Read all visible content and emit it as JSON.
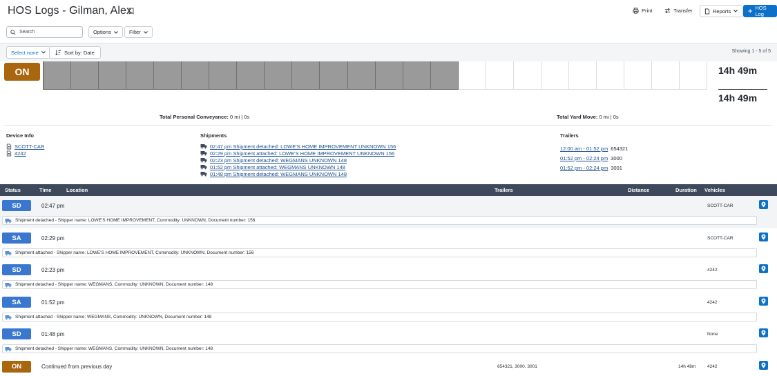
{
  "header": {
    "title": "HOS Logs - Gilman, Alex",
    "print_label": "Print",
    "transfer_label": "Transfer",
    "reports_label": "Reports",
    "hos_log_label": "HOS Log"
  },
  "toolbar": {
    "search_placeholder": "Search",
    "options_label": "Options",
    "filter_label": "Filter",
    "select_label": "Select none",
    "sort_label": "Sort by: Date",
    "showing": "Showing 1 - 5 of 5"
  },
  "chart": {
    "status_badge": "ON",
    "total_top": "14h 49m",
    "total_bottom": "14h 49m",
    "personal_conveyance_label": "Total Personal Conveyance:",
    "personal_conveyance_value": "0 mi | 0s",
    "yard_move_label": "Total Yard Move:",
    "yard_move_value": "0 mi | 0s",
    "on_duty_fraction": 0.617
  },
  "device_info": {
    "title": "Device Info",
    "items": [
      "SCOTT-CAR",
      "4242"
    ]
  },
  "shipments": {
    "title": "Shipments",
    "items": [
      "02:47 pm Shipment detached: LOWE'S HOME IMPROVEMENT UNKNOWN 156",
      "02:29 pm Shipment attached: LOWE'S HOME IMPROVEMENT UNKNOWN 156",
      "02:23 pm Shipment detached: WEGMANS UNKNOWN 148",
      "01:52 pm Shipment attached: WEGMANS UNKNOWN 148",
      "01:48 pm Shipment detached: WEGMANS UNKNOWN 148"
    ]
  },
  "trailers": {
    "title": "Trailers",
    "items": [
      {
        "range": "12:00 am - 01:52 pm",
        "id": "654321"
      },
      {
        "range": "01:52 pm - 02:24 pm",
        "id": "3000"
      },
      {
        "range": "01:52 pm - 02:24 pm",
        "id": "3001"
      }
    ]
  },
  "table": {
    "columns": {
      "status": "Status",
      "time": "Time",
      "location": "Location",
      "trailers": "Trailers",
      "distance": "Distance",
      "duration": "Duration",
      "vehicles": "Vehicles"
    },
    "rows": [
      {
        "status": "SD",
        "time": "02:47 pm",
        "vehicle": "SCOTT-CAR",
        "note": "Shipment detached - Shipper name: LOWE'S HOME IMPROVEMENT, Commodity: UNKNOWN, Document number: 156"
      },
      {
        "status": "SA",
        "time": "02:29 pm",
        "vehicle": "SCOTT-CAR",
        "note": "Shipment attached - Shipper name: LOWE'S HOME IMPROVEMENT, Commodity: UNKNOWN, Document number: 156"
      },
      {
        "status": "SD",
        "time": "02:23 pm",
        "vehicle": "4242",
        "note": "Shipment detached - Shipper name: WEGMANS, Commodity: UNKNOWN, Document number: 148"
      },
      {
        "status": "SA",
        "time": "01:52 pm",
        "vehicle": "4242",
        "note": "Shipment attached - Shipper name: WEGMANS, Commodity: UNKNOWN, Document number: 148"
      },
      {
        "status": "SD",
        "time": "01:48 pm",
        "vehicle": "None",
        "note": "Shipment detached - Shipper name: WEGMANS, Commodity: UNKNOWN, Document number: 148"
      }
    ],
    "last_row": {
      "status": "ON",
      "time": "Continued from previous day",
      "trailers": "654321, 3000, 3001",
      "duration": "14h 48m",
      "vehicle": "4242"
    }
  },
  "colors": {
    "accent": "#0c71c9",
    "status_blue": "#3a78cf",
    "status_on": "#a9660f",
    "header_bg": "#3e4a5c"
  }
}
